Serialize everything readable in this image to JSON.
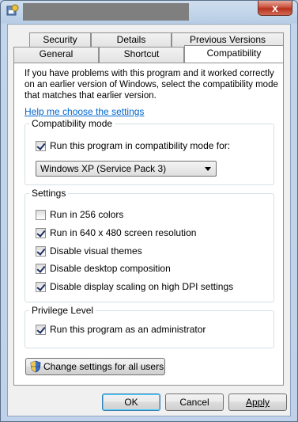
{
  "tabs_row1": [
    {
      "label": "Security"
    },
    {
      "label": "Details"
    },
    {
      "label": "Previous Versions"
    }
  ],
  "tabs_row2": [
    {
      "label": "General"
    },
    {
      "label": "Shortcut"
    },
    {
      "label": "Compatibility",
      "selected": true
    }
  ],
  "intro_text": "If you have problems with this program and it worked correctly on an earlier version of Windows, select the compatibility mode that matches that earlier version.",
  "help_link": "Help me choose the settings",
  "compat_mode": {
    "title": "Compatibility mode",
    "checkbox_label": "Run this program in compatibility mode for:",
    "checked": true,
    "selected_os": "Windows XP (Service Pack 3)"
  },
  "settings": {
    "title": "Settings",
    "items": [
      {
        "label": "Run in 256 colors",
        "checked": false
      },
      {
        "label": "Run in 640 x 480 screen resolution",
        "checked": true
      },
      {
        "label": "Disable visual themes",
        "checked": true
      },
      {
        "label": "Disable desktop composition",
        "checked": true
      },
      {
        "label": "Disable display scaling on high DPI settings",
        "checked": true
      }
    ]
  },
  "privilege": {
    "title": "Privilege Level",
    "checkbox_label": "Run this program as an administrator",
    "checked": true
  },
  "change_all_users": "Change settings for all users",
  "buttons": {
    "ok": "OK",
    "cancel": "Cancel",
    "apply": "Apply"
  },
  "title_bar": {
    "close_glyph": "x"
  }
}
